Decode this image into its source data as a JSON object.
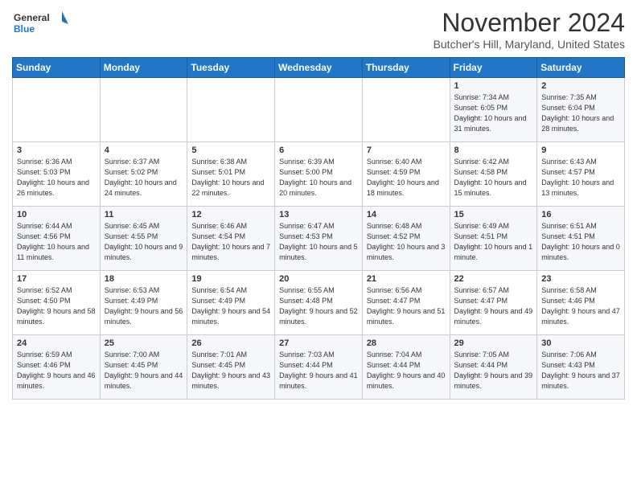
{
  "header": {
    "logo_line1": "General",
    "logo_line2": "Blue",
    "month": "November 2024",
    "location": "Butcher's Hill, Maryland, United States"
  },
  "days_of_week": [
    "Sunday",
    "Monday",
    "Tuesday",
    "Wednesday",
    "Thursday",
    "Friday",
    "Saturday"
  ],
  "weeks": [
    [
      {
        "day": "",
        "info": ""
      },
      {
        "day": "",
        "info": ""
      },
      {
        "day": "",
        "info": ""
      },
      {
        "day": "",
        "info": ""
      },
      {
        "day": "",
        "info": ""
      },
      {
        "day": "1",
        "info": "Sunrise: 7:34 AM\nSunset: 6:05 PM\nDaylight: 10 hours and 31 minutes."
      },
      {
        "day": "2",
        "info": "Sunrise: 7:35 AM\nSunset: 6:04 PM\nDaylight: 10 hours and 28 minutes."
      }
    ],
    [
      {
        "day": "3",
        "info": "Sunrise: 6:36 AM\nSunset: 5:03 PM\nDaylight: 10 hours and 26 minutes."
      },
      {
        "day": "4",
        "info": "Sunrise: 6:37 AM\nSunset: 5:02 PM\nDaylight: 10 hours and 24 minutes."
      },
      {
        "day": "5",
        "info": "Sunrise: 6:38 AM\nSunset: 5:01 PM\nDaylight: 10 hours and 22 minutes."
      },
      {
        "day": "6",
        "info": "Sunrise: 6:39 AM\nSunset: 5:00 PM\nDaylight: 10 hours and 20 minutes."
      },
      {
        "day": "7",
        "info": "Sunrise: 6:40 AM\nSunset: 4:59 PM\nDaylight: 10 hours and 18 minutes."
      },
      {
        "day": "8",
        "info": "Sunrise: 6:42 AM\nSunset: 4:58 PM\nDaylight: 10 hours and 15 minutes."
      },
      {
        "day": "9",
        "info": "Sunrise: 6:43 AM\nSunset: 4:57 PM\nDaylight: 10 hours and 13 minutes."
      }
    ],
    [
      {
        "day": "10",
        "info": "Sunrise: 6:44 AM\nSunset: 4:56 PM\nDaylight: 10 hours and 11 minutes."
      },
      {
        "day": "11",
        "info": "Sunrise: 6:45 AM\nSunset: 4:55 PM\nDaylight: 10 hours and 9 minutes."
      },
      {
        "day": "12",
        "info": "Sunrise: 6:46 AM\nSunset: 4:54 PM\nDaylight: 10 hours and 7 minutes."
      },
      {
        "day": "13",
        "info": "Sunrise: 6:47 AM\nSunset: 4:53 PM\nDaylight: 10 hours and 5 minutes."
      },
      {
        "day": "14",
        "info": "Sunrise: 6:48 AM\nSunset: 4:52 PM\nDaylight: 10 hours and 3 minutes."
      },
      {
        "day": "15",
        "info": "Sunrise: 6:49 AM\nSunset: 4:51 PM\nDaylight: 10 hours and 1 minute."
      },
      {
        "day": "16",
        "info": "Sunrise: 6:51 AM\nSunset: 4:51 PM\nDaylight: 10 hours and 0 minutes."
      }
    ],
    [
      {
        "day": "17",
        "info": "Sunrise: 6:52 AM\nSunset: 4:50 PM\nDaylight: 9 hours and 58 minutes."
      },
      {
        "day": "18",
        "info": "Sunrise: 6:53 AM\nSunset: 4:49 PM\nDaylight: 9 hours and 56 minutes."
      },
      {
        "day": "19",
        "info": "Sunrise: 6:54 AM\nSunset: 4:49 PM\nDaylight: 9 hours and 54 minutes."
      },
      {
        "day": "20",
        "info": "Sunrise: 6:55 AM\nSunset: 4:48 PM\nDaylight: 9 hours and 52 minutes."
      },
      {
        "day": "21",
        "info": "Sunrise: 6:56 AM\nSunset: 4:47 PM\nDaylight: 9 hours and 51 minutes."
      },
      {
        "day": "22",
        "info": "Sunrise: 6:57 AM\nSunset: 4:47 PM\nDaylight: 9 hours and 49 minutes."
      },
      {
        "day": "23",
        "info": "Sunrise: 6:58 AM\nSunset: 4:46 PM\nDaylight: 9 hours and 47 minutes."
      }
    ],
    [
      {
        "day": "24",
        "info": "Sunrise: 6:59 AM\nSunset: 4:46 PM\nDaylight: 9 hours and 46 minutes."
      },
      {
        "day": "25",
        "info": "Sunrise: 7:00 AM\nSunset: 4:45 PM\nDaylight: 9 hours and 44 minutes."
      },
      {
        "day": "26",
        "info": "Sunrise: 7:01 AM\nSunset: 4:45 PM\nDaylight: 9 hours and 43 minutes."
      },
      {
        "day": "27",
        "info": "Sunrise: 7:03 AM\nSunset: 4:44 PM\nDaylight: 9 hours and 41 minutes."
      },
      {
        "day": "28",
        "info": "Sunrise: 7:04 AM\nSunset: 4:44 PM\nDaylight: 9 hours and 40 minutes."
      },
      {
        "day": "29",
        "info": "Sunrise: 7:05 AM\nSunset: 4:44 PM\nDaylight: 9 hours and 39 minutes."
      },
      {
        "day": "30",
        "info": "Sunrise: 7:06 AM\nSunset: 4:43 PM\nDaylight: 9 hours and 37 minutes."
      }
    ]
  ]
}
